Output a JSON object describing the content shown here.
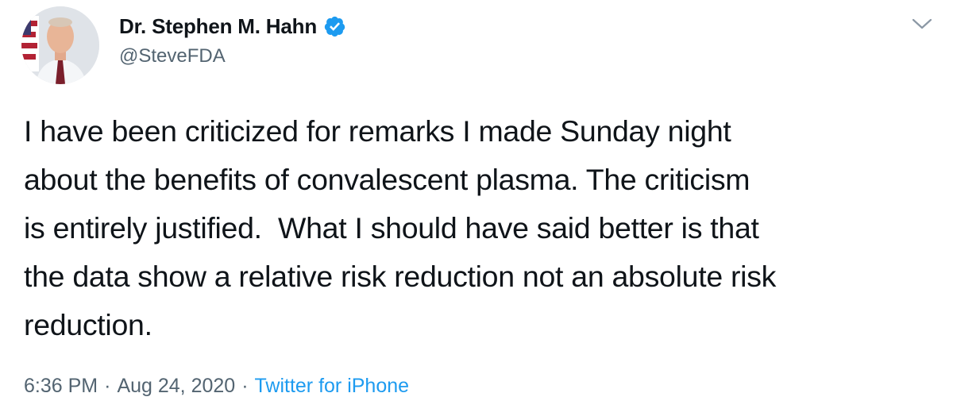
{
  "author": {
    "display_name": "Dr. Stephen M. Hahn",
    "handle": "@SteveFDA",
    "verified": true,
    "avatar_icon": "profile-photo"
  },
  "tweet": {
    "text": "I have been criticized for remarks I made Sunday night\nabout the benefits of convalescent plasma. The criticism\nis entirely justified.  What I should have said better is that\nthe data show a relative risk reduction not an absolute risk\nreduction.",
    "time": "6:36 PM",
    "separator1": "·",
    "date": "Aug 24, 2020",
    "separator2": "·",
    "source": "Twitter for iPhone"
  },
  "icons": {
    "verified": "verified-badge-icon",
    "menu": "chevron-down-icon"
  },
  "colors": {
    "text": "#0f1419",
    "secondary": "#536471",
    "accent": "#1d9bf0"
  }
}
